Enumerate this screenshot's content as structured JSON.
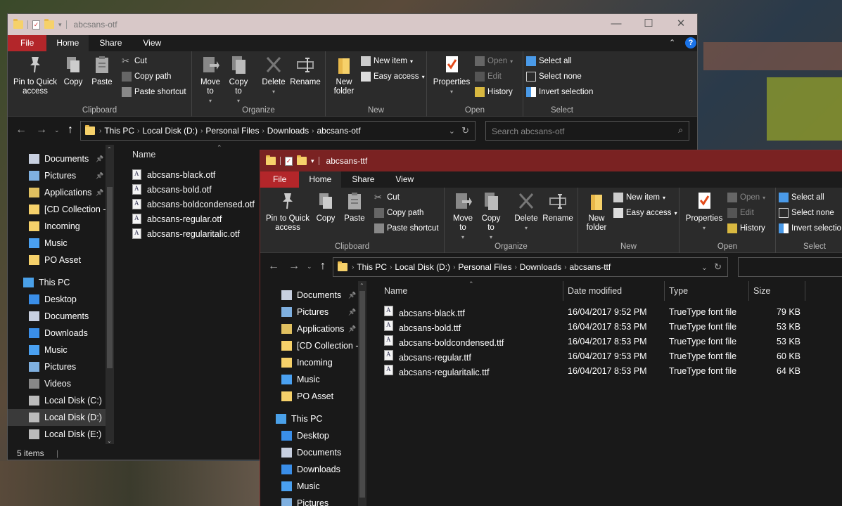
{
  "win1": {
    "title": "abcsans-otf",
    "tabs": {
      "file": "File",
      "home": "Home",
      "share": "Share",
      "view": "View"
    },
    "ribbon": {
      "pin": "Pin to Quick access",
      "copy": "Copy",
      "paste": "Paste",
      "cut": "Cut",
      "copy_path": "Copy path",
      "paste_shortcut": "Paste shortcut",
      "clipboard": "Clipboard",
      "move_to": "Move to",
      "copy_to": "Copy to",
      "delete": "Delete",
      "rename": "Rename",
      "organize": "Organize",
      "new_folder": "New folder",
      "new_item": "New item",
      "easy_access": "Easy access",
      "new": "New",
      "properties": "Properties",
      "open": "Open",
      "edit": "Edit",
      "history": "History",
      "open_group": "Open",
      "select_all": "Select all",
      "select_none": "Select none",
      "invert_selection": "Invert selection",
      "select": "Select"
    },
    "breadcrumb": [
      "This PC",
      "Local Disk (D:)",
      "Personal Files",
      "Downloads",
      "abcsans-otf"
    ],
    "search_placeholder": "Search abcsans-otf",
    "nav": [
      {
        "label": "Documents",
        "pinned": true
      },
      {
        "label": "Pictures",
        "pinned": true
      },
      {
        "label": "Applications",
        "pinned": true
      },
      {
        "label": "[CD Collection -"
      },
      {
        "label": "Incoming"
      },
      {
        "label": "Music"
      },
      {
        "label": "PO Asset"
      },
      {
        "label": "This PC"
      },
      {
        "label": "Desktop"
      },
      {
        "label": "Documents"
      },
      {
        "label": "Downloads"
      },
      {
        "label": "Music"
      },
      {
        "label": "Pictures"
      },
      {
        "label": "Videos"
      },
      {
        "label": "Local Disk (C:)"
      },
      {
        "label": "Local Disk (D:)",
        "selected": true
      },
      {
        "label": "Local Disk (E:)"
      }
    ],
    "column_name": "Name",
    "files": [
      "abcsans-black.otf",
      "abcsans-bold.otf",
      "abcsans-boldcondensed.otf",
      "abcsans-regular.otf",
      "abcsans-regularitalic.otf"
    ],
    "status": "5 items"
  },
  "win2": {
    "title": "abcsans-ttf",
    "tabs": {
      "file": "File",
      "home": "Home",
      "share": "Share",
      "view": "View"
    },
    "breadcrumb": [
      "This PC",
      "Local Disk (D:)",
      "Personal Files",
      "Downloads",
      "abcsans-ttf"
    ],
    "columns": {
      "name": "Name",
      "date": "Date modified",
      "type": "Type",
      "size": "Size"
    },
    "files": [
      {
        "name": "abcsans-black.ttf",
        "date": "16/04/2017 9:52 PM",
        "type": "TrueType font file",
        "size": "79 KB"
      },
      {
        "name": "abcsans-bold.ttf",
        "date": "16/04/2017 8:53 PM",
        "type": "TrueType font file",
        "size": "53 KB"
      },
      {
        "name": "abcsans-boldcondensed.ttf",
        "date": "16/04/2017 8:53 PM",
        "type": "TrueType font file",
        "size": "53 KB"
      },
      {
        "name": "abcsans-regular.ttf",
        "date": "16/04/2017 9:53 PM",
        "type": "TrueType font file",
        "size": "60 KB"
      },
      {
        "name": "abcsans-regularitalic.ttf",
        "date": "16/04/2017 8:53 PM",
        "type": "TrueType font file",
        "size": "64 KB"
      }
    ],
    "nav": [
      {
        "label": "Documents",
        "pinned": true
      },
      {
        "label": "Pictures",
        "pinned": true
      },
      {
        "label": "Applications",
        "pinned": true
      },
      {
        "label": "[CD Collection -"
      },
      {
        "label": "Incoming"
      },
      {
        "label": "Music"
      },
      {
        "label": "PO Asset"
      },
      {
        "label": "This PC"
      },
      {
        "label": "Desktop"
      },
      {
        "label": "Documents"
      },
      {
        "label": "Downloads"
      },
      {
        "label": "Music"
      },
      {
        "label": "Pictures"
      }
    ],
    "select_selection_truncated": "Invert selectio"
  },
  "colors": {
    "file_tab": "#b3262a",
    "title_active": "#7a2222",
    "title_inactive": "#d8c8c8",
    "bg": "#191919",
    "ribbon": "#2b2b2b"
  }
}
